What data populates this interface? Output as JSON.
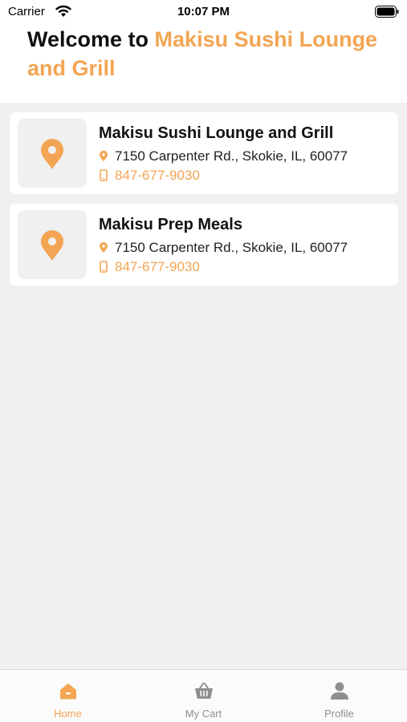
{
  "status_bar": {
    "carrier": "Carrier",
    "time": "10:07 PM"
  },
  "header": {
    "welcome_prefix": "Welcome to ",
    "welcome_accent": "Makisu Sushi Lounge and Grill"
  },
  "theme": {
    "accent": "#f3a553",
    "background": "#f0f0f0"
  },
  "locations": [
    {
      "name": "Makisu Sushi Lounge and Grill",
      "address": "7150 Carpenter Rd., Skokie, IL, 60077",
      "phone": "847-677-9030",
      "icon": "location-pin-icon"
    },
    {
      "name": "Makisu Prep Meals",
      "address": "7150 Carpenter Rd., Skokie, IL, 60077",
      "phone": "847-677-9030",
      "icon": "location-pin-icon"
    }
  ],
  "tabbar": {
    "tabs": [
      {
        "label": "Home",
        "icon": "home-icon",
        "active": true
      },
      {
        "label": "My Cart",
        "icon": "basket-icon",
        "active": false
      },
      {
        "label": "Profile",
        "icon": "person-icon",
        "active": false
      }
    ]
  }
}
